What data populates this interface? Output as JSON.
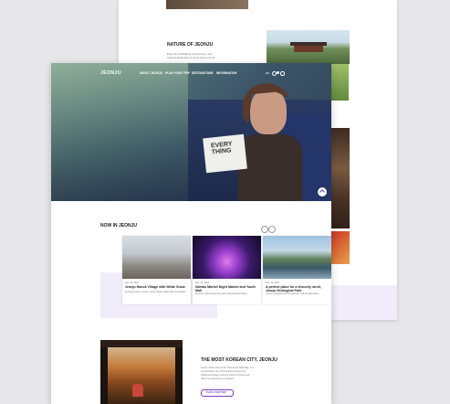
{
  "back_page": {
    "nature_title": "NATURE OF JEONJU",
    "nature_body": [
      "Enjoy the breathtaking natural scenery and",
      "seasonal landscapes of Jeonju all year round."
    ]
  },
  "header": {
    "logo": "JEONJU",
    "nav": [
      "ABOUT JEONJU",
      "PLAN YOUR TRIP",
      "DESTINATIONS",
      "INFORMATION"
    ],
    "lang": "EN"
  },
  "hero": {
    "book_text": "EVERY THING"
  },
  "now_section": {
    "title": "NOW IN JEONJU",
    "cards": [
      {
        "date": "Dec. 20. 2023",
        "title": "Jeonju Hanok Village with White Snow",
        "desc": "During the winter season, Jeonju Hanok Village will look beautiful."
      },
      {
        "date": "Dec. 20. 2023",
        "title": "Nambu Market Night Market and Youth Mall",
        "desc": "Enjoy the night market and youth mall at Nambu Market."
      },
      {
        "date": "Dec. 20. 2023",
        "title": "A perfect place for a leisurely stroll, Jeonju Ecological Park",
        "desc": "A quiet ecological park for a leisurely walk through nature."
      }
    ]
  },
  "korean_section": {
    "title": "THE MOST KOREAN CITY, JEONJU",
    "body": [
      "Jeonju, which refers to the 'Hanok' and 'Bibimbap', is a",
      "representative city of Korea that preserves the",
      "traditional heritage, food and culture of Korea, and",
      "offers rich experiences to travelers."
    ],
    "button": "PLAN YOUR TRIP"
  },
  "colors": {
    "accent": "#7a3ec8",
    "lavender": "#f0ecf9"
  }
}
